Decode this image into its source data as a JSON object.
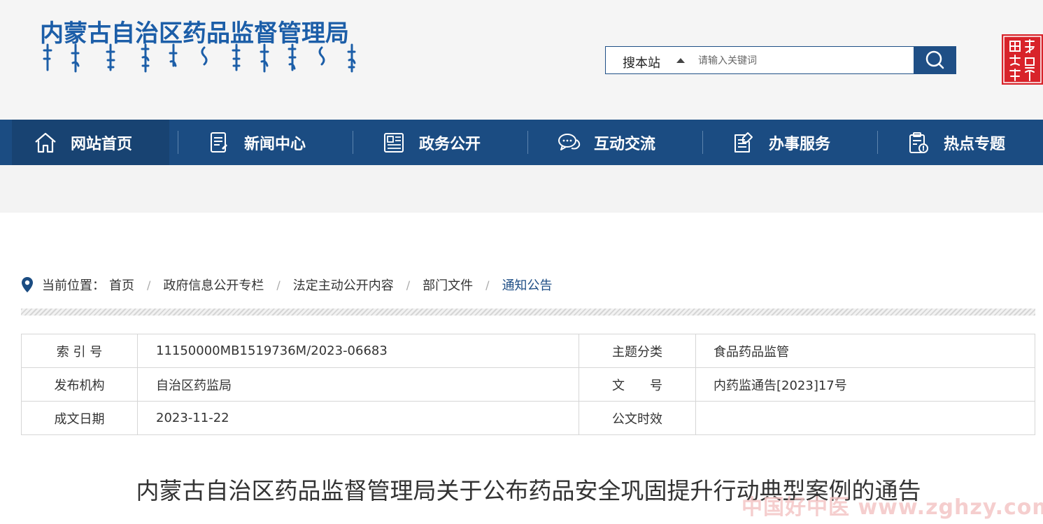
{
  "header": {
    "title": "内蒙古自治区药品监督管理局",
    "search": {
      "scope_label": "搜本站",
      "placeholder": "请输入关键词"
    }
  },
  "nav": {
    "items": [
      {
        "label": "网站首页",
        "icon": "home-icon",
        "active": true
      },
      {
        "label": "新闻中心",
        "icon": "news-icon",
        "active": false
      },
      {
        "label": "政务公开",
        "icon": "gov-affairs-icon",
        "active": false
      },
      {
        "label": "互动交流",
        "icon": "chat-icon",
        "active": false
      },
      {
        "label": "办事服务",
        "icon": "service-icon",
        "active": false
      },
      {
        "label": "热点专题",
        "icon": "hot-topic-icon",
        "active": false
      }
    ]
  },
  "breadcrumb": {
    "prefix": "当前位置：",
    "separator": "/",
    "items": [
      "首页",
      "政府信息公开专栏",
      "法定主动公开内容",
      "部门文件",
      "通知公告"
    ]
  },
  "meta": {
    "rows": [
      {
        "k1": "索 引 号",
        "v1": "11150000MB1519736M/2023-06683",
        "k2": "主题分类",
        "v2": "食品药品监管"
      },
      {
        "k1": "发布机构",
        "v1": "自治区药监局",
        "k2": "文　　号",
        "v2": "内药监通告[2023]17号"
      },
      {
        "k1": "成文日期",
        "v1": "2023-11-22",
        "k2": "公文时效",
        "v2": ""
      }
    ]
  },
  "article": {
    "title": "内蒙古自治区药品监督管理局关于公布药品安全巩固提升行动典型案例的通告"
  },
  "watermark": "中国好中医 www.zghzy.com",
  "colors": {
    "brand_blue": "#1c5ea8",
    "nav_bg": "#1b4c82",
    "nav_active": "#184372",
    "seal_red": "#d8232a"
  }
}
